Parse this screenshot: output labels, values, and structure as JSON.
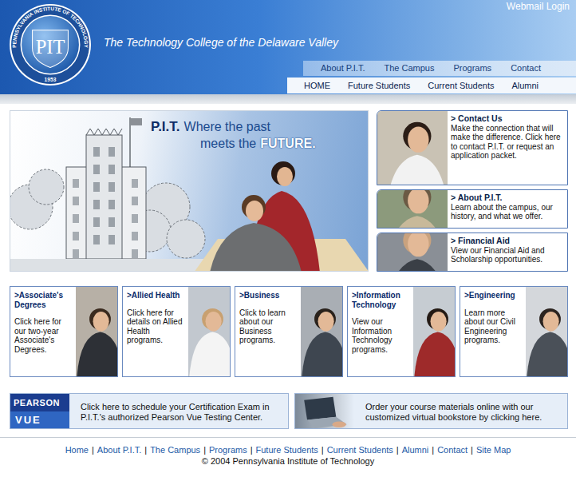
{
  "header": {
    "webmail": "Webmail Login",
    "tagline": "The Technology College of the Delaware Valley",
    "logo": {
      "initials": "PIT",
      "ring": "PENNSYLVANIA INSTITUTE OF TECHNOLOGY",
      "year": "1953"
    }
  },
  "nav_primary": [
    "About P.I.T.",
    "The Campus",
    "Programs",
    "Contact"
  ],
  "nav_secondary": [
    "HOME",
    "Future Students",
    "Current Students",
    "Alumni"
  ],
  "hero": {
    "brand": "P.I.T.",
    "line1": "Where the past",
    "line2": "meets the",
    "highlight": "FUTURE."
  },
  "side_boxes": [
    {
      "title": "> Contact Us",
      "text": "Make the connection that will make the difference. Click here to contact P.I.T. or request an application packet."
    },
    {
      "title": "> About P.I.T.",
      "text": "Learn about the campus, our history, and what we offer."
    },
    {
      "title": "> Financial Aid",
      "text": "View our Financial Aid and Scholarship opportunities."
    }
  ],
  "programs": [
    {
      "title": ">Associate's Degrees",
      "text": "Click here for our two-year Associate's Degrees."
    },
    {
      "title": ">Allied Health",
      "text": "Click here for details on Allied Health programs."
    },
    {
      "title": ">Business",
      "text": "Click to learn about our Business programs."
    },
    {
      "title": ">Information Technology",
      "text": "View our Information Technology programs."
    },
    {
      "title": ">Engineering",
      "text": "Learn more about our Civil Engineering programs."
    }
  ],
  "banners": {
    "pearson": {
      "logo_top": "PEARSON",
      "logo_bottom": "VUE",
      "text": "Click here to schedule your Certification Exam in P.I.T.'s authorized Pearson Vue Testing Center."
    },
    "bookstore": {
      "text": "Order your course materials online with our customized virtual bookstore by clicking here."
    }
  },
  "footer": {
    "links": [
      "Home",
      "About P.I.T.",
      "The Campus",
      "Programs",
      "Future Students",
      "Current Students",
      "Alumni",
      "Contact",
      "Site Map"
    ],
    "separator": "|",
    "copyright": "© 2004 Pennsylvania Institute of Technology"
  }
}
